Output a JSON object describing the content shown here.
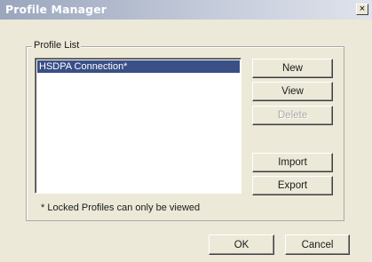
{
  "window": {
    "title": "Profile Manager",
    "close_glyph": "×"
  },
  "group": {
    "label": "Profile List"
  },
  "profiles": [
    {
      "name": "HSDPA Connection*",
      "selected": true
    }
  ],
  "buttons": {
    "new": "New",
    "view": "View",
    "delete": "Delete",
    "import": "Import",
    "export": "Export",
    "ok": "OK",
    "cancel": "Cancel"
  },
  "note": "* Locked Profiles can only be viewed",
  "colors": {
    "selection": "#3a4f86",
    "face": "#ece9d8"
  }
}
